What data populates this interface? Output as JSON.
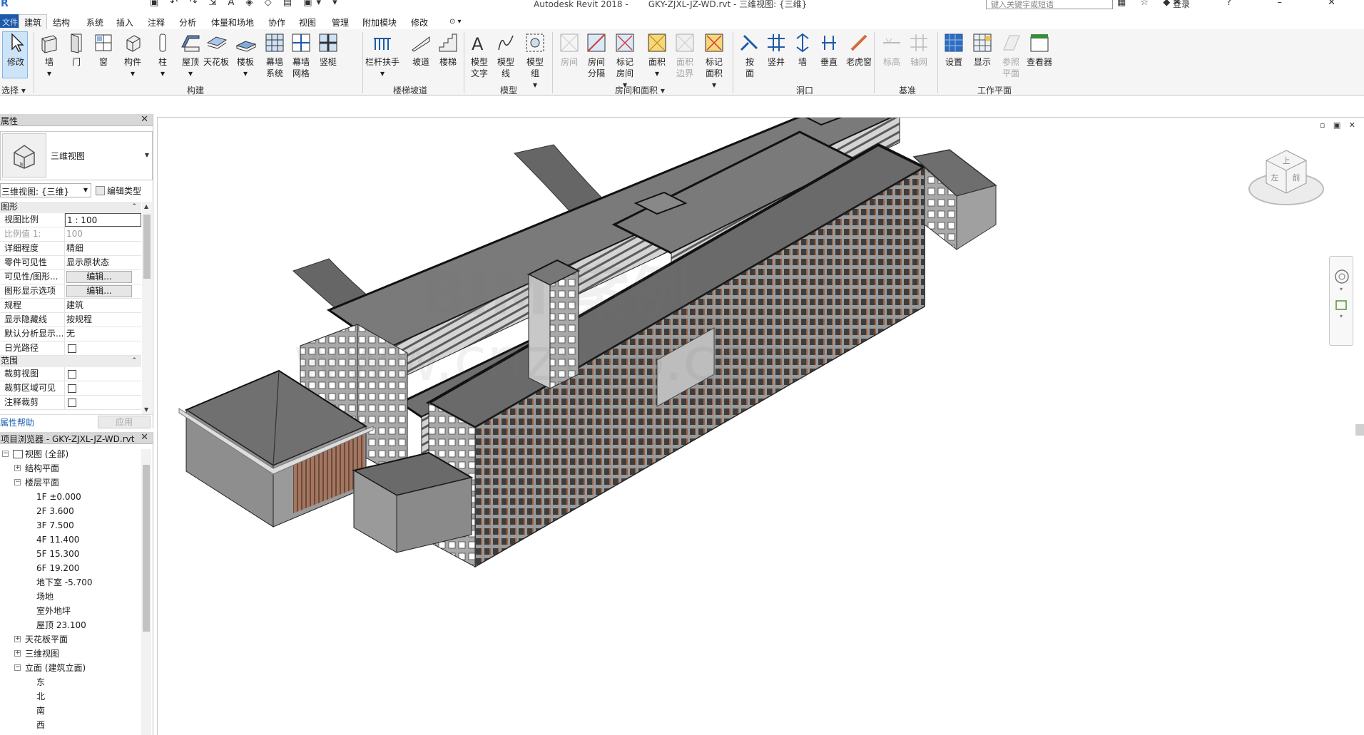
{
  "titlebar": {
    "app_title": "Autodesk Revit 2018 -",
    "file_title": "GKY-ZJXL-JZ-WD.rvt - 三维视图: {三维}",
    "search_placeholder": "键入关键字或短语",
    "login": "登录"
  },
  "menu": {
    "file": "文件",
    "tabs": [
      "建筑",
      "结构",
      "系统",
      "插入",
      "注释",
      "分析",
      "体量和场地",
      "协作",
      "视图",
      "管理",
      "附加模块",
      "修改"
    ],
    "active_tab": "建筑"
  },
  "ribbon": {
    "modify": "修改",
    "select": "选择",
    "build": [
      "墙",
      "门",
      "窗",
      "构件",
      "柱",
      "屋顶",
      "天花板",
      "楼板",
      "幕墙\n系统",
      "幕墙\n网格",
      "竖梃"
    ],
    "build_group": "构建",
    "stairs": [
      "栏杆扶手",
      "坡道",
      "楼梯"
    ],
    "stairs_group": "楼梯坡道",
    "model": [
      "模型\n文字",
      "模型\n线",
      "模型\n组"
    ],
    "model_group": "模型",
    "room": [
      "房间",
      "房间\n分隔",
      "标记\n房间",
      "面积",
      "面积\n边界",
      "标记\n面积"
    ],
    "room_group": "房间和面积",
    "opening": [
      "按\n面",
      "竖井",
      "墙",
      "垂直",
      "老虎窗"
    ],
    "opening_group": "洞口",
    "datum": [
      "标高",
      "轴网"
    ],
    "datum_group": "基准",
    "workplane": [
      "设置",
      "显示",
      "参照\n平面",
      "查看器"
    ],
    "workplane_group": "工作平面"
  },
  "properties": {
    "title": "属性",
    "type_name": "三维视图",
    "selector": "三维视图: {三维}",
    "edit_type": "编辑类型",
    "sections": [
      {
        "name": "图形",
        "rows": [
          {
            "k": "视图比例",
            "v": "1 : 100",
            "style": "box"
          },
          {
            "k": "比例值 1:",
            "v": "100",
            "style": "dim"
          },
          {
            "k": "详细程度",
            "v": "精细"
          },
          {
            "k": "零件可见性",
            "v": "显示原状态"
          },
          {
            "k": "可见性/图形...",
            "v": "编辑...",
            "style": "btn"
          },
          {
            "k": "图形显示选项",
            "v": "编辑...",
            "style": "btn"
          },
          {
            "k": "规程",
            "v": "建筑"
          },
          {
            "k": "显示隐藏线",
            "v": "按规程"
          },
          {
            "k": "默认分析显示...",
            "v": "无"
          },
          {
            "k": "日光路径",
            "v": "",
            "style": "chk"
          }
        ]
      },
      {
        "name": "范围",
        "rows": [
          {
            "k": "裁剪视图",
            "v": "",
            "style": "chk"
          },
          {
            "k": "裁剪区域可见",
            "v": "",
            "style": "chk"
          },
          {
            "k": "注释裁剪",
            "v": "",
            "style": "chk"
          }
        ]
      }
    ],
    "help": "属性帮助",
    "apply": "应用"
  },
  "browser": {
    "title": "项目浏览器 - GKY-ZJXL-JZ-WD.rvt",
    "tree": [
      {
        "label": "视图 (全部)",
        "level": 0,
        "toggle": "-",
        "icon": true
      },
      {
        "label": "结构平面",
        "level": 1,
        "toggle": "+"
      },
      {
        "label": "楼层平面",
        "level": 1,
        "toggle": "-"
      },
      {
        "label": "1F ±0.000",
        "level": 2
      },
      {
        "label": "2F 3.600",
        "level": 2
      },
      {
        "label": "3F 7.500",
        "level": 2
      },
      {
        "label": "4F 11.400",
        "level": 2
      },
      {
        "label": "5F 15.300",
        "level": 2
      },
      {
        "label": "6F 19.200",
        "level": 2
      },
      {
        "label": "地下室 -5.700",
        "level": 2
      },
      {
        "label": "场地",
        "level": 2
      },
      {
        "label": "室外地坪",
        "level": 2
      },
      {
        "label": "屋顶 23.100",
        "level": 2
      },
      {
        "label": "天花板平面",
        "level": 1,
        "toggle": "+"
      },
      {
        "label": "三维视图",
        "level": 1,
        "toggle": "+"
      },
      {
        "label": "立面 (建筑立面)",
        "level": 1,
        "toggle": "-"
      },
      {
        "label": "东",
        "level": 2
      },
      {
        "label": "北",
        "level": 2
      },
      {
        "label": "南",
        "level": 2
      },
      {
        "label": "西",
        "level": 2
      }
    ]
  },
  "viewcube": {
    "top": "上",
    "left": "左",
    "front": "前"
  },
  "watermark": {
    "line1": "BIM 案例",
    "line2": "www.cnzyao.com"
  },
  "colors": {
    "accent": "#1e5aa8",
    "facade": "#9a9a9a",
    "roof": "#6e6e6e",
    "louver": "#9a5a3a"
  }
}
